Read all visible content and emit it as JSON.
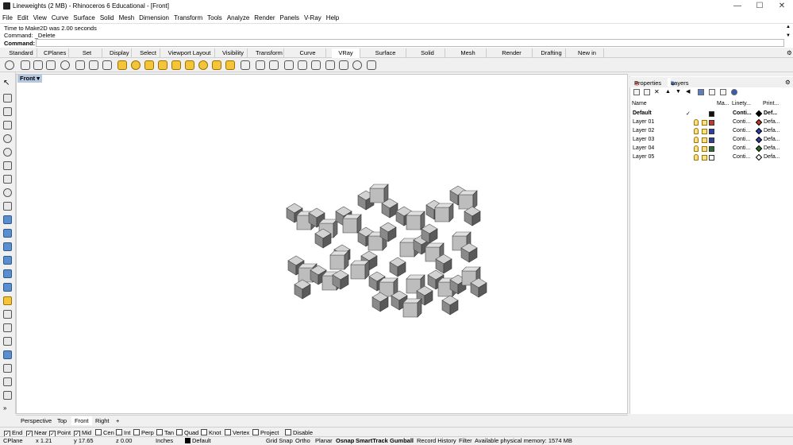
{
  "window": {
    "title": "Lineweights (2 MB) - Rhinoceros 6 Educational - [Front]",
    "minimize": "—",
    "maximize": "☐",
    "close": "✕"
  },
  "menu": [
    "File",
    "Edit",
    "View",
    "Curve",
    "Surface",
    "Solid",
    "Mesh",
    "Dimension",
    "Transform",
    "Tools",
    "Analyze",
    "Render",
    "Panels",
    "V-Ray",
    "Help"
  ],
  "command_history": [
    "Time to Make2D was 2.00 seconds",
    "Command: _Delete"
  ],
  "command_prompt": "Command:",
  "toolbar_tabs": [
    "Standard",
    "CPlanes",
    "Set View",
    "Display",
    "Select",
    "Viewport Layout",
    "Visibility",
    "Transform",
    "Curve Tools",
    "VRay All",
    "Surface Tools",
    "Solid Tools",
    "Mesh Tools",
    "Render Tools",
    "Drafting",
    "New in V6"
  ],
  "active_toolbar_tab": "VRay All",
  "viewport": {
    "name": "Front"
  },
  "viewport_tabs": [
    "Perspective",
    "Top",
    "Front",
    "Right"
  ],
  "active_viewport_tab": "Front",
  "panel": {
    "tabs": [
      "Properties",
      "Layers"
    ],
    "active_tab": "Layers",
    "columns": {
      "name": "Name",
      "material": "Ma...",
      "linetype": "Linety...",
      "print": "Print..."
    },
    "layers": [
      {
        "name": "Default",
        "current": true,
        "check": "✓",
        "color": "#111111",
        "linetype": "Conti...",
        "print": "Def..."
      },
      {
        "name": "Layer 01",
        "current": false,
        "color": "#c0392b",
        "linetype": "Conti...",
        "print": "Defa..."
      },
      {
        "name": "Layer 02",
        "current": false,
        "color": "#2c3ea8",
        "linetype": "Conti...",
        "print": "Defa..."
      },
      {
        "name": "Layer 03",
        "current": false,
        "color": "#3a3a9a",
        "linetype": "Conti...",
        "print": "Defa..."
      },
      {
        "name": "Layer 04",
        "current": false,
        "color": "#2e6b2e",
        "linetype": "Conti...",
        "print": "Defa..."
      },
      {
        "name": "Layer 05",
        "current": false,
        "color": "#ffffff",
        "linetype": "Conti...",
        "print": "Defa..."
      }
    ]
  },
  "osnaps": [
    {
      "label": "End",
      "checked": true
    },
    {
      "label": "Near",
      "checked": true
    },
    {
      "label": "Point",
      "checked": true
    },
    {
      "label": "Mid",
      "checked": true
    },
    {
      "label": "Cen",
      "checked": false
    },
    {
      "label": "Int",
      "checked": false
    },
    {
      "label": "Perp",
      "checked": false
    },
    {
      "label": "Tan",
      "checked": false
    },
    {
      "label": "Quad",
      "checked": false
    },
    {
      "label": "Knot",
      "checked": false
    },
    {
      "label": "Vertex",
      "checked": false
    },
    {
      "label": "Project",
      "checked": false
    },
    {
      "label": "Disable",
      "checked": false
    }
  ],
  "status": {
    "cplane": "CPlane",
    "x": "x 1.21",
    "y": "y 17.65",
    "z": "z 0.00",
    "units": "Inches",
    "layer": "Default",
    "toggles": [
      "Grid Snap",
      "Ortho",
      "Planar",
      "Osnap",
      "SmartTrack",
      "Gumball",
      "Record History",
      "Filter"
    ],
    "memory": "Available physical memory: 1574 MB"
  }
}
